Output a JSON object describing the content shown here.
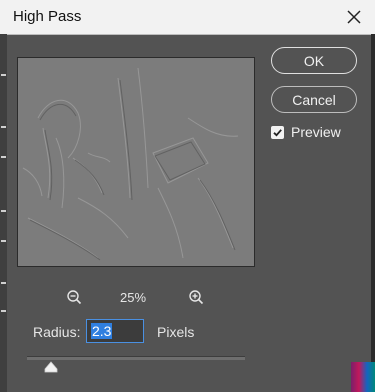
{
  "dialog": {
    "title": "High Pass"
  },
  "buttons": {
    "ok_label": "OK",
    "cancel_label": "Cancel"
  },
  "preview": {
    "label": "Preview",
    "checked": true
  },
  "zoom": {
    "value": "25%"
  },
  "radius": {
    "label": "Radius:",
    "value": "2.3",
    "unit": "Pixels"
  },
  "icons": {
    "close": "close-icon",
    "zoom_out": "zoom-out-icon",
    "zoom_in": "zoom-in-icon",
    "checkbox": "checkmark-icon",
    "slider": "slider-thumb-icon"
  },
  "colors": {
    "dialog_background": "#535353",
    "titlebar": "#f2f2f2",
    "preview_gray": "#7b7b7b",
    "selection_blue": "#2f7fe0"
  }
}
